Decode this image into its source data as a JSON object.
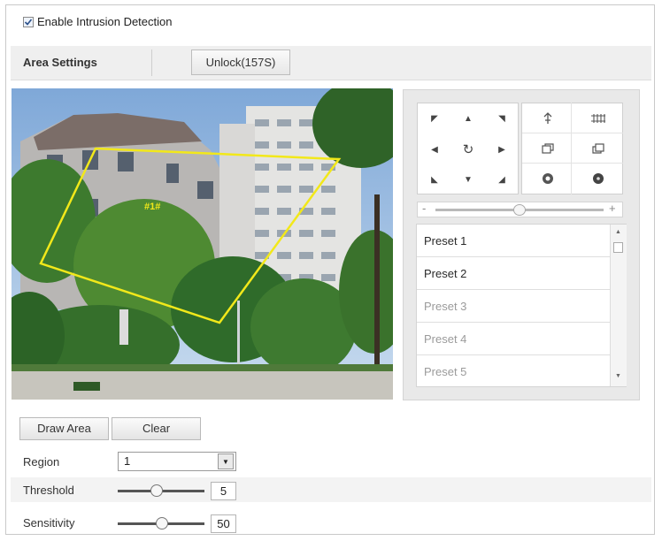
{
  "header": {
    "enable_label": "Enable Intrusion Detection",
    "enable_checked": true
  },
  "tabs": {
    "area_settings": "Area Settings",
    "unlock_button": "Unlock(157S)"
  },
  "video": {
    "region_tag": "#1#",
    "region_color": "#f2e81a"
  },
  "ptz": {
    "direction_icons": [
      "arrow-up-left-icon",
      "arrow-up-icon",
      "arrow-up-right-icon",
      "arrow-left-icon",
      "auto-rotate-icon",
      "arrow-right-icon",
      "arrow-down-left-icon",
      "arrow-down-icon",
      "arrow-down-right-icon"
    ],
    "function_icons": [
      "zoom-in-icon",
      "zoom-out-icon",
      "focus-near-icon",
      "focus-far-icon",
      "iris-open-icon",
      "iris-close-icon"
    ],
    "speed_minus": "-",
    "speed_plus": "+",
    "speed_level": 0.5
  },
  "presets": [
    {
      "label": "Preset 1",
      "configured": true
    },
    {
      "label": "Preset 2",
      "configured": true
    },
    {
      "label": "Preset 3",
      "configured": false
    },
    {
      "label": "Preset 4",
      "configured": false
    },
    {
      "label": "Preset 5",
      "configured": false
    }
  ],
  "controls": {
    "draw_area": "Draw Area",
    "clear": "Clear",
    "region_label": "Region",
    "region_value": "1",
    "threshold_label": "Threshold",
    "threshold_value": "5",
    "sensitivity_label": "Sensitivity",
    "sensitivity_value": "50"
  }
}
